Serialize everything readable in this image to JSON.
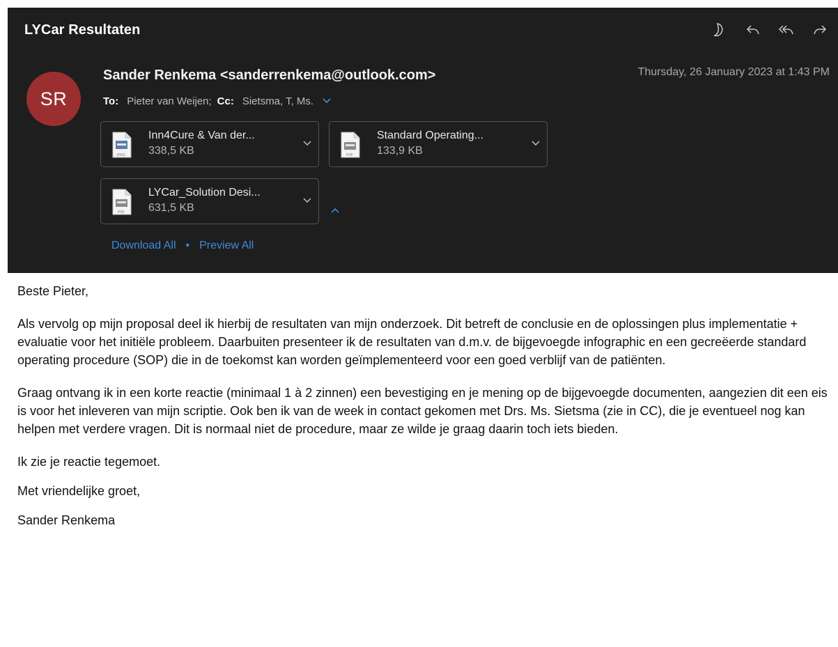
{
  "email": {
    "subject": "LYCar Resultaten",
    "sender": "Sander Renkema <sanderrenkema@outlook.com>",
    "avatar_initials": "SR",
    "avatar_color": "#9b2f2f",
    "date": "Thursday, 26 January 2023 at 1:43 PM",
    "to_label": "To:",
    "to_value": "Pieter van Weijen;",
    "cc_label": "Cc:",
    "cc_value": "Sietsma, T, Ms.",
    "actions": [
      "moon-icon",
      "reply-icon",
      "reply-all-icon",
      "forward-icon"
    ]
  },
  "attachments": [
    {
      "name": "Inn4Cure & Van der...",
      "size": "338,5 KB",
      "type": "JPEG"
    },
    {
      "name": "Standard Operating...",
      "size": "133,9 KB",
      "type": "PDF"
    },
    {
      "name": "LYCar_Solution Desi...",
      "size": "631,5 KB",
      "type": "PDF"
    }
  ],
  "links": {
    "download_all": "Download All",
    "separator": "•",
    "preview_all": "Preview All"
  },
  "body": {
    "greeting": "Beste Pieter,",
    "paragraph1": "Als vervolg op mijn proposal deel ik hierbij de resultaten van mijn onderzoek. Dit betreft de conclusie en de oplossingen plus implementatie + evaluatie voor het initiële probleem. Daarbuiten presenteer ik de resultaten van d.m.v. de bijgevoegde infographic en een gecreëerde standard operating procedure (SOP) die in de toekomst kan worden geïmplementeerd voor een goed verblijf van de patiënten.",
    "paragraph2": "Graag ontvang ik in een korte reactie (minimaal 1 à 2 zinnen) een bevestiging en je mening op de bijgevoegde documenten, aangezien dit een eis is voor het inleveren van mijn scriptie. Ook ben ik van de week in contact gekomen met Drs. Ms. Sietsma (zie in CC), die je eventueel nog kan helpen met verdere vragen. Dit is normaal niet de procedure, maar ze wilde je graag daarin toch iets bieden.",
    "closing1": "Ik zie je reactie tegemoet.",
    "closing2": "Met vriendelijke groet,",
    "signature": "Sander Renkema"
  },
  "colors": {
    "header_bg": "#1e1e1e",
    "link": "#3d8bd9",
    "body_bg": "#ffffff"
  }
}
